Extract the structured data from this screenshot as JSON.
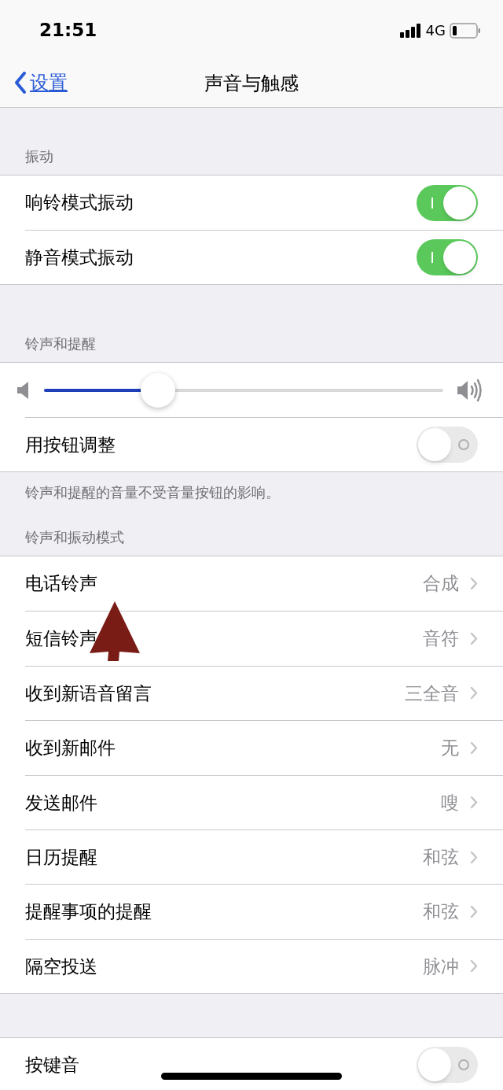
{
  "status_bar": {
    "time": "21:51",
    "network": "4G"
  },
  "nav": {
    "back": "设置",
    "title": "声音与触感"
  },
  "vibration": {
    "header": "振动",
    "rows": [
      {
        "label": "响铃模式振动",
        "on": true
      },
      {
        "label": "静音模式振动",
        "on": true
      }
    ]
  },
  "ringer": {
    "header": "铃声和提醒",
    "volume": {
      "level": 0.285
    },
    "buttons_row": {
      "label": "用按钮调整",
      "on": false
    },
    "footer": "铃声和提醒的音量不受音量按钮的影响。"
  },
  "patterns": {
    "header": "铃声和振动模式",
    "rows": [
      {
        "label": "电话铃声",
        "value": "合成"
      },
      {
        "label": "短信铃声",
        "value": "音符"
      },
      {
        "label": "收到新语音留言",
        "value": "三全音"
      },
      {
        "label": "收到新邮件",
        "value": "无"
      },
      {
        "label": "发送邮件",
        "value": "嗖"
      },
      {
        "label": "日历提醒",
        "value": "和弦"
      },
      {
        "label": "提醒事项的提醒",
        "value": "和弦"
      },
      {
        "label": "隔空投送",
        "value": "脉冲"
      }
    ]
  },
  "keyboard": {
    "label": "按键音",
    "on": false
  }
}
